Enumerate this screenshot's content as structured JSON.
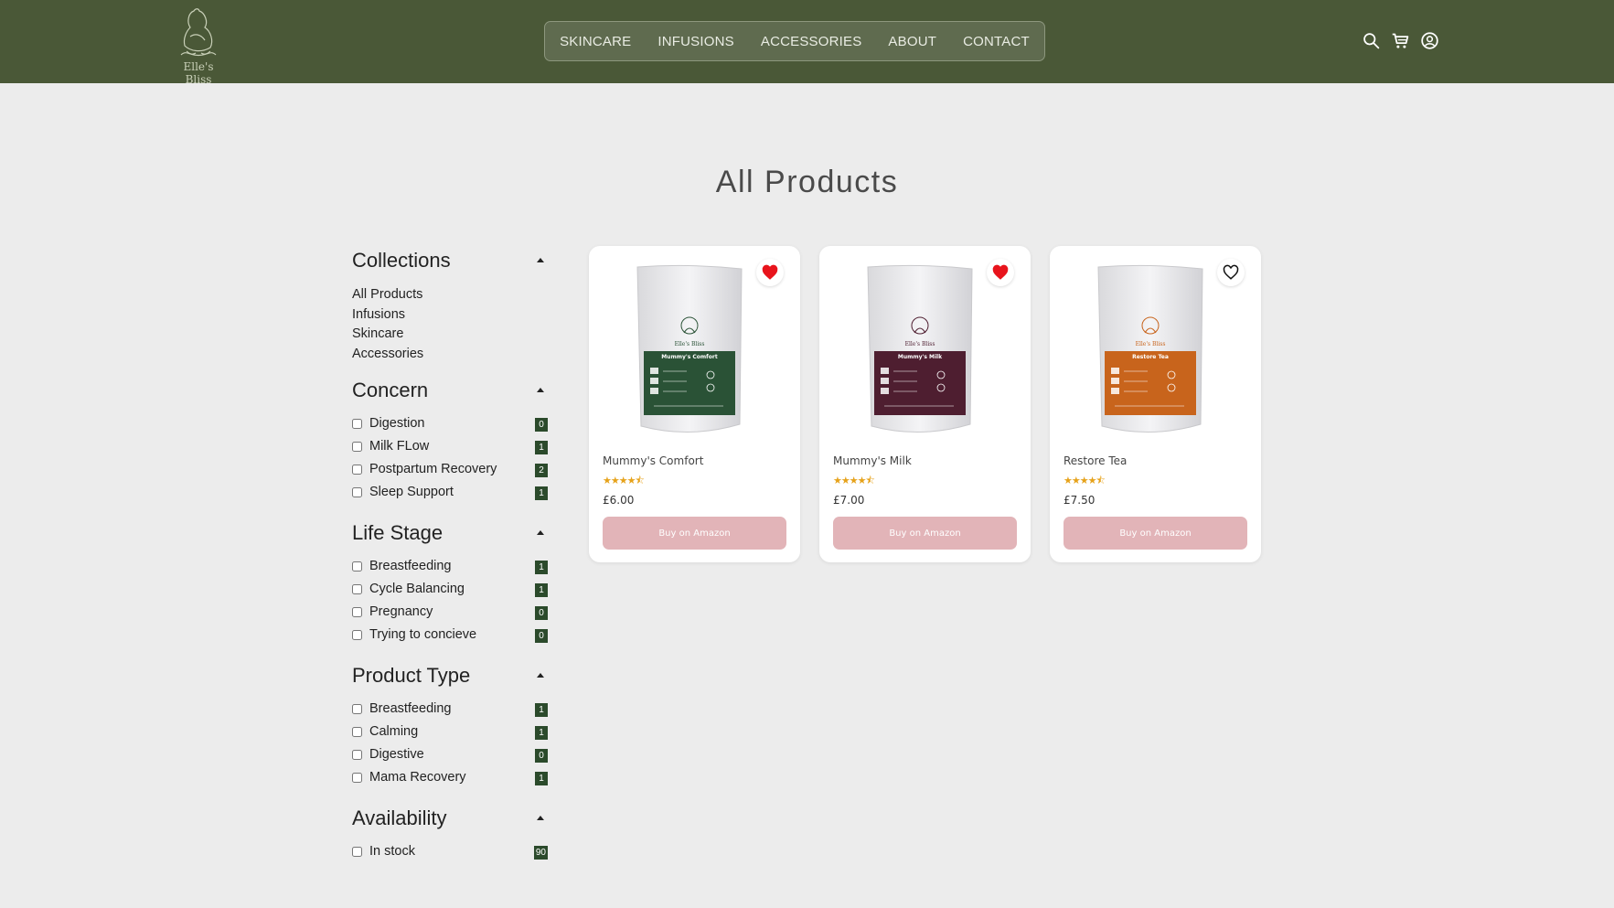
{
  "brand": {
    "name": "Elle's Bliss"
  },
  "nav": {
    "links": [
      "SKINCARE",
      "INFUSIONS",
      "ACCESSORIES",
      "ABOUT",
      "CONTACT"
    ]
  },
  "header_icons": [
    "search-icon",
    "cart-icon",
    "user-icon"
  ],
  "page_title": "All Products",
  "filters": {
    "collections": {
      "title": "Collections",
      "links": [
        "All Products",
        "Infusions",
        "Skincare",
        "Accessories"
      ]
    },
    "concern": {
      "title": "Concern",
      "options": [
        {
          "label": "Digestion",
          "count": "0"
        },
        {
          "label": "Milk FLow",
          "count": "1"
        },
        {
          "label": "Postpartum Recovery",
          "count": "2"
        },
        {
          "label": "Sleep Support",
          "count": "1"
        }
      ]
    },
    "life_stage": {
      "title": "Life Stage",
      "options": [
        {
          "label": "Breastfeeding",
          "count": "1"
        },
        {
          "label": "Cycle Balancing",
          "count": "1"
        },
        {
          "label": "Pregnancy",
          "count": "0"
        },
        {
          "label": "Trying to concieve",
          "count": "0"
        }
      ]
    },
    "product_type": {
      "title": "Product Type",
      "options": [
        {
          "label": "Breastfeeding",
          "count": "1"
        },
        {
          "label": "Calming",
          "count": "1"
        },
        {
          "label": "Digestive",
          "count": "0"
        },
        {
          "label": "Mama Recovery",
          "count": "1"
        }
      ]
    },
    "availability": {
      "title": "Availability",
      "options": [
        {
          "label": "In stock",
          "count": "90"
        }
      ]
    }
  },
  "products": [
    {
      "name": "Mummy's Comfort",
      "price": "£6.00",
      "rating": 4.5,
      "stars": "★★★★⯪",
      "favorited": true,
      "button": "Buy on Amazon",
      "band_color": "#2a5236",
      "band_text": "Mummy's Comfort"
    },
    {
      "name": "Mummy's Milk",
      "price": "£7.00",
      "rating": 4.5,
      "stars": "★★★★⯪",
      "favorited": true,
      "button": "Buy on Amazon",
      "band_color": "#4e1e30",
      "band_text": "Mummy's Milk"
    },
    {
      "name": "Restore Tea",
      "price": "£7.50",
      "rating": 4.5,
      "stars": "★★★★⯪",
      "favorited": false,
      "button": "Buy on Amazon",
      "band_color": "#c8641c",
      "band_text": "Restore Tea"
    }
  ],
  "colors": {
    "header": "#4a5837",
    "badge": "#2b4a2b",
    "heart": "#e8141c",
    "buy_button": "#e2b4b8"
  }
}
